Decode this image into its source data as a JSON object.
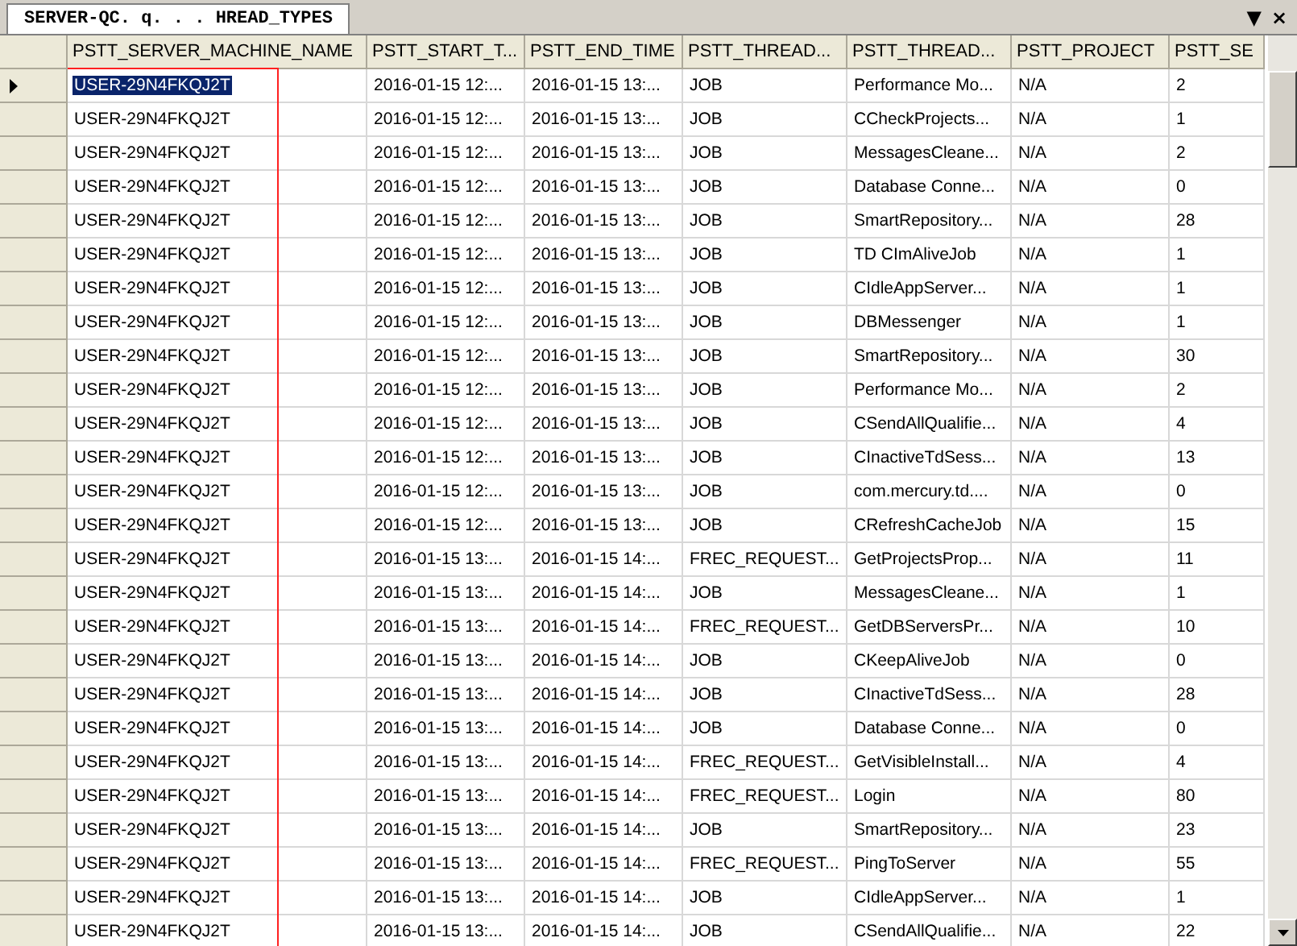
{
  "tab": {
    "title": "SERVER-QC. q. . . HREAD_TYPES",
    "selected": true
  },
  "tab_controls": [
    "▼",
    "×"
  ],
  "table": {
    "columns": [
      "PSTT_SERVER_MACHINE_NAME",
      "PSTT_START_T...",
      "PSTT_END_TIME",
      "PSTT_THREAD...",
      "PSTT_THREAD...",
      "PSTT_PROJECT",
      "PSTT_SE"
    ],
    "rows": [
      {
        "selected": true,
        "cells": [
          "USER-29N4FKQJ2T",
          "2016-01-15 12:...",
          "2016-01-15 13:...",
          "JOB",
          "Performance Mo...",
          "N/A",
          "2"
        ]
      },
      {
        "selected": false,
        "cells": [
          "USER-29N4FKQJ2T",
          "2016-01-15 12:...",
          "2016-01-15 13:...",
          "JOB",
          "CCheckProjects...",
          "N/A",
          "1"
        ]
      },
      {
        "selected": false,
        "cells": [
          "USER-29N4FKQJ2T",
          "2016-01-15 12:...",
          "2016-01-15 13:...",
          "JOB",
          "MessagesCleane...",
          "N/A",
          "2"
        ]
      },
      {
        "selected": false,
        "cells": [
          "USER-29N4FKQJ2T",
          "2016-01-15 12:...",
          "2016-01-15 13:...",
          "JOB",
          "Database Conne...",
          "N/A",
          "0"
        ]
      },
      {
        "selected": false,
        "cells": [
          "USER-29N4FKQJ2T",
          "2016-01-15 12:...",
          "2016-01-15 13:...",
          "JOB",
          "SmartRepository...",
          "N/A",
          "28"
        ]
      },
      {
        "selected": false,
        "cells": [
          "USER-29N4FKQJ2T",
          "2016-01-15 12:...",
          "2016-01-15 13:...",
          "JOB",
          "TD CImAliveJob",
          "N/A",
          "1"
        ]
      },
      {
        "selected": false,
        "cells": [
          "USER-29N4FKQJ2T",
          "2016-01-15 12:...",
          "2016-01-15 13:...",
          "JOB",
          "CIdleAppServer...",
          "N/A",
          "1"
        ]
      },
      {
        "selected": false,
        "cells": [
          "USER-29N4FKQJ2T",
          "2016-01-15 12:...",
          "2016-01-15 13:...",
          "JOB",
          "DBMessenger",
          "N/A",
          "1"
        ]
      },
      {
        "selected": false,
        "cells": [
          "USER-29N4FKQJ2T",
          "2016-01-15 12:...",
          "2016-01-15 13:...",
          "JOB",
          "SmartRepository...",
          "N/A",
          "30"
        ]
      },
      {
        "selected": false,
        "cells": [
          "USER-29N4FKQJ2T",
          "2016-01-15 12:...",
          "2016-01-15 13:...",
          "JOB",
          "Performance Mo...",
          "N/A",
          "2"
        ]
      },
      {
        "selected": false,
        "cells": [
          "USER-29N4FKQJ2T",
          "2016-01-15 12:...",
          "2016-01-15 13:...",
          "JOB",
          "CSendAllQualifie...",
          "N/A",
          "4"
        ]
      },
      {
        "selected": false,
        "cells": [
          "USER-29N4FKQJ2T",
          "2016-01-15 12:...",
          "2016-01-15 13:...",
          "JOB",
          "CInactiveTdSess...",
          "N/A",
          "13"
        ]
      },
      {
        "selected": false,
        "cells": [
          "USER-29N4FKQJ2T",
          "2016-01-15 12:...",
          "2016-01-15 13:...",
          "JOB",
          "com.mercury.td....",
          "N/A",
          "0"
        ]
      },
      {
        "selected": false,
        "cells": [
          "USER-29N4FKQJ2T",
          "2016-01-15 12:...",
          "2016-01-15 13:...",
          "JOB",
          "CRefreshCacheJob",
          "N/A",
          "15"
        ]
      },
      {
        "selected": false,
        "cells": [
          "USER-29N4FKQJ2T",
          "2016-01-15 13:...",
          "2016-01-15 14:...",
          "FREC_REQUEST...",
          "GetProjectsProp...",
          "N/A",
          "11"
        ]
      },
      {
        "selected": false,
        "cells": [
          "USER-29N4FKQJ2T",
          "2016-01-15 13:...",
          "2016-01-15 14:...",
          "JOB",
          "MessagesCleane...",
          "N/A",
          "1"
        ]
      },
      {
        "selected": false,
        "cells": [
          "USER-29N4FKQJ2T",
          "2016-01-15 13:...",
          "2016-01-15 14:...",
          "FREC_REQUEST...",
          "GetDBServersPr...",
          "N/A",
          "10"
        ]
      },
      {
        "selected": false,
        "cells": [
          "USER-29N4FKQJ2T",
          "2016-01-15 13:...",
          "2016-01-15 14:...",
          "JOB",
          "CKeepAliveJob",
          "N/A",
          "0"
        ]
      },
      {
        "selected": false,
        "cells": [
          "USER-29N4FKQJ2T",
          "2016-01-15 13:...",
          "2016-01-15 14:...",
          "JOB",
          "CInactiveTdSess...",
          "N/A",
          "28"
        ]
      },
      {
        "selected": false,
        "cells": [
          "USER-29N4FKQJ2T",
          "2016-01-15 13:...",
          "2016-01-15 14:...",
          "JOB",
          "Database Conne...",
          "N/A",
          "0"
        ]
      },
      {
        "selected": false,
        "cells": [
          "USER-29N4FKQJ2T",
          "2016-01-15 13:...",
          "2016-01-15 14:...",
          "FREC_REQUEST...",
          "GetVisibleInstall...",
          "N/A",
          "4"
        ]
      },
      {
        "selected": false,
        "cells": [
          "USER-29N4FKQJ2T",
          "2016-01-15 13:...",
          "2016-01-15 14:...",
          "FREC_REQUEST...",
          "Login",
          "N/A",
          "80"
        ]
      },
      {
        "selected": false,
        "cells": [
          "USER-29N4FKQJ2T",
          "2016-01-15 13:...",
          "2016-01-15 14:...",
          "JOB",
          "SmartRepository...",
          "N/A",
          "23"
        ]
      },
      {
        "selected": false,
        "cells": [
          "USER-29N4FKQJ2T",
          "2016-01-15 13:...",
          "2016-01-15 14:...",
          "FREC_REQUEST...",
          "PingToServer",
          "N/A",
          "55"
        ]
      },
      {
        "selected": false,
        "cells": [
          "USER-29N4FKQJ2T",
          "2016-01-15 13:...",
          "2016-01-15 14:...",
          "JOB",
          "CIdleAppServer...",
          "N/A",
          "1"
        ]
      },
      {
        "selected": false,
        "cells": [
          "USER-29N4FKQJ2T",
          "2016-01-15 13:...",
          "2016-01-15 14:...",
          "JOB",
          "CSendAllQualifie...",
          "N/A",
          "22"
        ]
      }
    ]
  }
}
